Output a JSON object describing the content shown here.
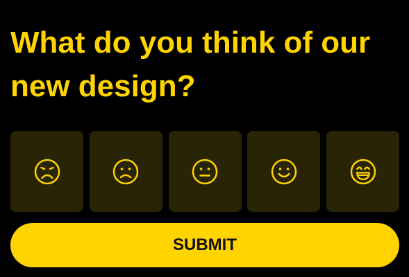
{
  "question": {
    "text": "What do you think of our new design?"
  },
  "rating_options": [
    {
      "icon": "very-sad-face-icon"
    },
    {
      "icon": "sad-face-icon"
    },
    {
      "icon": "neutral-face-icon"
    },
    {
      "icon": "smile-face-icon"
    },
    {
      "icon": "grin-face-icon"
    }
  ],
  "submit": {
    "label": "SUBMIT"
  },
  "colors": {
    "background": "#000000",
    "accent": "#FFD400",
    "option_background": "#2A2407",
    "button_text": "#111111"
  }
}
